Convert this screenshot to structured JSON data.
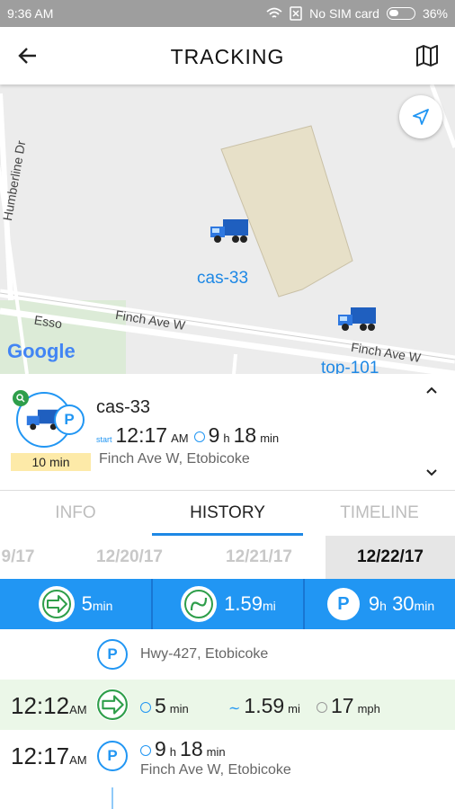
{
  "status_bar": {
    "time": "9:36 AM",
    "sim": "No SIM card",
    "battery": "36%"
  },
  "app_bar": {
    "title": "TRACKING"
  },
  "map": {
    "streets": [
      "Humberline Dr",
      "Finch Ave W",
      "Finch Ave W"
    ],
    "poi": "Esso",
    "logo": "Google",
    "vehicles": [
      "cas-33",
      "top-101"
    ]
  },
  "vehicle_card": {
    "name": "cas-33",
    "badge": "10 min",
    "start_label": "start",
    "start_time": "12:17",
    "start_ampm": "AM",
    "duration_h": "9",
    "duration_h_unit": "h",
    "duration_m": "18",
    "duration_m_unit": "min",
    "address": "Finch Ave W, Etobicoke"
  },
  "tabs": [
    "INFO",
    "HISTORY",
    "TIMELINE"
  ],
  "dates": [
    "9/17",
    "12/20/17",
    "12/21/17",
    "12/22/17"
  ],
  "summary": {
    "moving": {
      "value": "5",
      "unit": "min"
    },
    "distance": {
      "value": "1.59",
      "unit": "mi"
    },
    "parked": {
      "value_h": "9",
      "unit_h": "h",
      "value_m": "30",
      "unit_m": "min"
    }
  },
  "timeline": {
    "row1": {
      "address": "Hwy-427, Etobicoke"
    },
    "row2": {
      "time": "12:12",
      "ampm": "AM",
      "dur": "5",
      "dur_unit": "min",
      "dist": "1.59",
      "dist_unit": "mi",
      "speed": "17",
      "speed_unit": "mph"
    },
    "row3": {
      "time": "12:17",
      "ampm": "AM",
      "dur_h": "9",
      "dur_h_unit": "h",
      "dur_m": "18",
      "dur_m_unit": "min",
      "address": "Finch Ave W, Etobicoke"
    }
  },
  "colors": {
    "accent": "#2196f3",
    "green": "#2e9e4a",
    "badge": "#fdeaa8"
  }
}
